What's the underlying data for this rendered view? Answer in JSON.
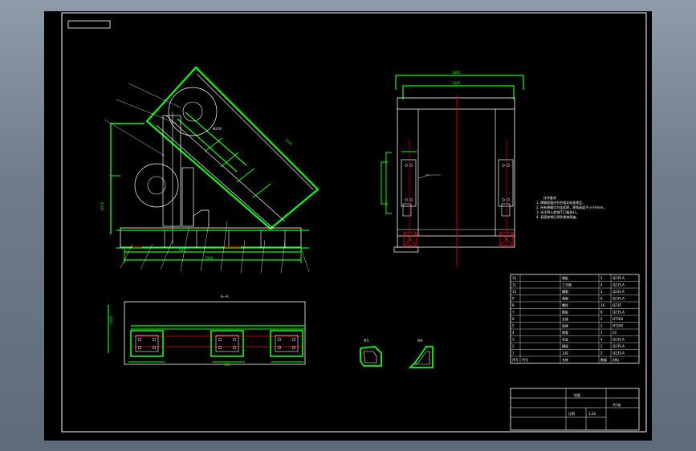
{
  "drawing": {
    "section_label": "A—A",
    "detail_labels": [
      "件5",
      "件6"
    ],
    "dimensions": {
      "top_width": "1800",
      "inner_width": "1400",
      "main_height": "2500",
      "base_length": "3300",
      "dim_a": "4070",
      "dim_b": "940",
      "tube_dia": "Φ219",
      "plan_width": "1000",
      "small_dim": "160"
    },
    "notes_heading": "技术要求",
    "notes": [
      "1. 焊缝质量应符合相关标准规定。",
      "2. 所有焊缝均为连续焊，焊角高度不小于6mm。",
      "3. 未注明公差按IT13级执行。",
      "4. 表面除锈后涂防锈漆两遍。"
    ]
  },
  "title_block": {
    "drawing_name": "机架",
    "scale_label": "比例",
    "scale": "1:20",
    "sheet": "共1张"
  },
  "bom": {
    "header": [
      "序号",
      "代号",
      "名称",
      "数量",
      "材料"
    ],
    "rows": [
      [
        "12",
        "",
        "钢板",
        "2",
        "Q235-A"
      ],
      [
        "11",
        "",
        "工字钢",
        "4",
        "Q235-A"
      ],
      [
        "10",
        "",
        "槽钢",
        "2",
        "Q235-A"
      ],
      [
        "9",
        "",
        "角钢",
        "6",
        "Q235-A"
      ],
      [
        "8",
        "",
        "螺栓",
        "16",
        "Q235"
      ],
      [
        "7",
        "",
        "筋板",
        "8",
        "Q235-A"
      ],
      [
        "6",
        "",
        "支座",
        "2",
        "HT200"
      ],
      [
        "5",
        "",
        "底座",
        "2",
        "HT200"
      ],
      [
        "4",
        "",
        "钢管",
        "1",
        "20"
      ],
      [
        "3",
        "",
        "吊耳",
        "4",
        "Q235-A"
      ],
      [
        "2",
        "",
        "横梁",
        "2",
        "Q235-A"
      ],
      [
        "1",
        "",
        "立柱",
        "2",
        "Q235-A"
      ]
    ]
  },
  "colors": {
    "background": "#000000",
    "outline": "#00ff00",
    "centerline": "#ff0000",
    "detail": "#ffffff",
    "dimension": "#ffff00",
    "border": "#ffffff"
  }
}
